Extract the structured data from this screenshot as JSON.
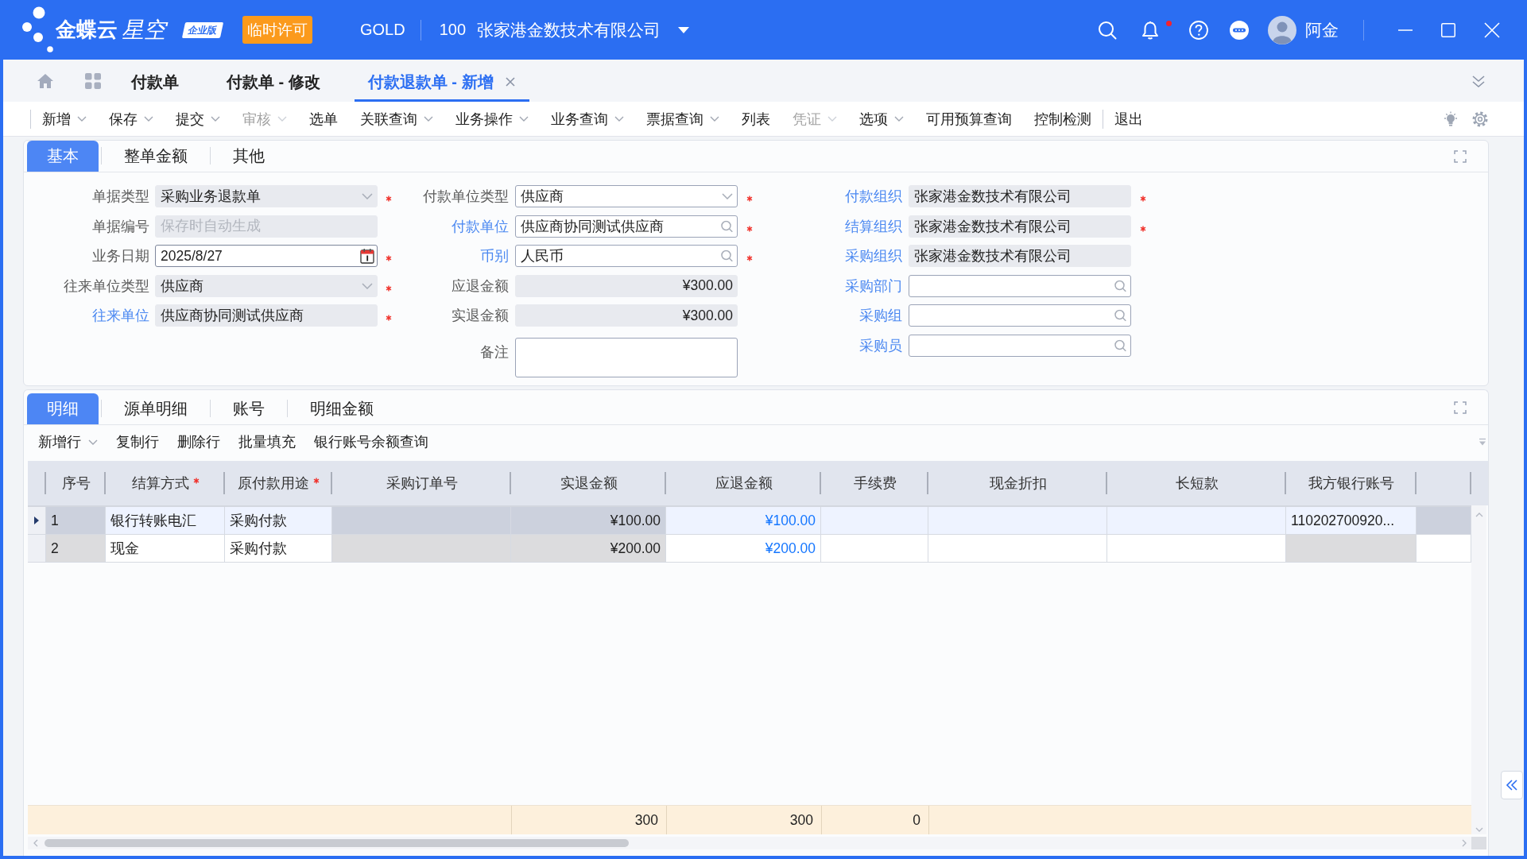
{
  "header": {
    "logo": {
      "brand": "金蝶云",
      "product": "星空",
      "edition": "企业版"
    },
    "license_badge": "临时许可",
    "data_center": "GOLD",
    "org_code": "100",
    "org_name": "张家港金数技术有限公司",
    "has_unread": true,
    "user": "阿金"
  },
  "tabs": [
    {
      "label": "付款单",
      "selected": false,
      "closable": false
    },
    {
      "label": "付款单 - 修改",
      "selected": false,
      "closable": false
    },
    {
      "label": "付款退款单 - 新增",
      "selected": true,
      "closable": true
    }
  ],
  "toolbar": {
    "groups": [
      [
        {
          "label": "新增",
          "dropdown": true,
          "disabled": false
        },
        {
          "label": "保存",
          "dropdown": true,
          "disabled": false
        },
        {
          "label": "提交",
          "dropdown": true,
          "disabled": false
        },
        {
          "label": "审核",
          "dropdown": true,
          "disabled": true
        },
        {
          "label": "选单",
          "dropdown": false,
          "disabled": false
        },
        {
          "label": "关联查询",
          "dropdown": true,
          "disabled": false
        },
        {
          "label": "业务操作",
          "dropdown": true,
          "disabled": false
        },
        {
          "label": "业务查询",
          "dropdown": true,
          "disabled": false
        },
        {
          "label": "票据查询",
          "dropdown": true,
          "disabled": false
        },
        {
          "label": "列表",
          "dropdown": false,
          "disabled": false
        },
        {
          "label": "凭证",
          "dropdown": true,
          "disabled": true
        },
        {
          "label": "选项",
          "dropdown": true,
          "disabled": false
        },
        {
          "label": "可用预算查询",
          "dropdown": false,
          "disabled": false
        },
        {
          "label": "控制检测",
          "dropdown": false,
          "disabled": false
        }
      ],
      [
        {
          "label": "退出",
          "dropdown": false,
          "disabled": false
        }
      ]
    ]
  },
  "form_panel": {
    "tabs": [
      {
        "label": "基本",
        "selected": true
      },
      {
        "label": "整单金额",
        "selected": false
      },
      {
        "label": "其他",
        "selected": false
      }
    ],
    "columns": [
      [
        {
          "label": "单据类型",
          "kind": "select",
          "editable": false,
          "linked": false,
          "required": true,
          "value": "采购业务退款单"
        },
        {
          "label": "单据编号",
          "kind": "text",
          "editable": false,
          "linked": false,
          "required": false,
          "placeholder": "保存时自动生成"
        },
        {
          "label": "业务日期",
          "kind": "date",
          "editable": true,
          "linked": false,
          "required": true,
          "value": "2025/8/27"
        },
        {
          "label": "往来单位类型",
          "kind": "select",
          "editable": false,
          "linked": false,
          "required": true,
          "value": "供应商"
        },
        {
          "label": "往来单位",
          "kind": "text",
          "editable": false,
          "linked": true,
          "required": true,
          "value": "供应商协同测试供应商"
        }
      ],
      [
        {
          "label": "付款单位类型",
          "kind": "select",
          "editable": true,
          "linked": false,
          "required": true,
          "value": "供应商"
        },
        {
          "label": "付款单位",
          "kind": "lookup",
          "editable": true,
          "linked": true,
          "required": true,
          "value": "供应商协同测试供应商"
        },
        {
          "label": "币别",
          "kind": "lookup",
          "editable": true,
          "linked": true,
          "required": true,
          "value": "人民币"
        },
        {
          "label": "应退金额",
          "kind": "amount",
          "editable": false,
          "linked": false,
          "required": false,
          "value": "¥300.00"
        },
        {
          "label": "实退金额",
          "kind": "amount",
          "editable": false,
          "linked": false,
          "required": false,
          "value": "¥300.00"
        },
        {
          "label": "备注",
          "kind": "textarea",
          "editable": true,
          "linked": false,
          "required": false
        }
      ],
      [
        {
          "label": "付款组织",
          "kind": "text",
          "editable": false,
          "linked": true,
          "required": true,
          "value": "张家港金数技术有限公司"
        },
        {
          "label": "结算组织",
          "kind": "text",
          "editable": false,
          "linked": true,
          "required": true,
          "value": "张家港金数技术有限公司"
        },
        {
          "label": "采购组织",
          "kind": "text",
          "editable": false,
          "linked": true,
          "required": false,
          "value": "张家港金数技术有限公司"
        },
        {
          "label": "采购部门",
          "kind": "lookup",
          "editable": true,
          "linked": true,
          "required": false
        },
        {
          "label": "采购组",
          "kind": "lookup",
          "editable": true,
          "linked": true,
          "required": false
        },
        {
          "label": "采购员",
          "kind": "lookup",
          "editable": true,
          "linked": true,
          "required": false
        }
      ]
    ]
  },
  "detail_panel": {
    "tabs": [
      {
        "label": "明细",
        "selected": true
      },
      {
        "label": "源单明细",
        "selected": false
      },
      {
        "label": "账号",
        "selected": false
      },
      {
        "label": "明细金额",
        "selected": false
      }
    ],
    "toolbar": [
      {
        "label": "新增行",
        "dropdown": true
      },
      {
        "label": "复制行",
        "dropdown": false
      },
      {
        "label": "删除行",
        "dropdown": false
      },
      {
        "label": "批量填充",
        "dropdown": false
      },
      {
        "label": "银行账号余额查询",
        "dropdown": false
      }
    ],
    "table": {
      "columns": [
        {
          "title": "序号",
          "kind": "text",
          "required": false
        },
        {
          "title": "结算方式",
          "kind": "text",
          "required": true
        },
        {
          "title": "原付款用途",
          "kind": "text",
          "required": true
        },
        {
          "title": "采购订单号",
          "kind": "text",
          "required": false
        },
        {
          "title": "实退金额",
          "kind": "amount",
          "required": false,
          "total": "300"
        },
        {
          "title": "应退金额",
          "kind": "link-amount",
          "required": false,
          "total": "300"
        },
        {
          "title": "手续费",
          "kind": "amount",
          "required": false,
          "total": "0"
        },
        {
          "title": "现金折扣",
          "kind": "amount",
          "required": false
        },
        {
          "title": "长短款",
          "kind": "amount",
          "required": false
        },
        {
          "title": "我方银行账号",
          "kind": "text",
          "required": false
        },
        {
          "kind": "filler"
        }
      ],
      "rows": [
        {
          "selected": true,
          "cells": [
            {
              "text": "1",
              "locked": true
            },
            {
              "text": "银行转账电汇",
              "locked": false
            },
            {
              "text": "采购付款",
              "locked": false
            },
            {
              "locked": true
            },
            {
              "text": "¥100.00",
              "locked": true
            },
            {
              "text": "¥100.00",
              "locked": false
            },
            {
              "locked": false
            },
            {
              "locked": false
            },
            {
              "locked": false
            },
            {
              "text": "110202700920...",
              "locked": false
            },
            {
              "locked": true
            }
          ]
        },
        {
          "selected": false,
          "cells": [
            {
              "text": "2",
              "locked": true
            },
            {
              "text": "现金",
              "locked": false
            },
            {
              "text": "采购付款",
              "locked": false
            },
            {
              "locked": true
            },
            {
              "text": "¥200.00",
              "locked": true
            },
            {
              "text": "¥200.00",
              "locked": false
            },
            {
              "locked": false
            },
            {
              "locked": false
            },
            {
              "locked": false
            },
            {
              "locked": true
            },
            {
              "locked": false
            }
          ]
        }
      ]
    }
  }
}
